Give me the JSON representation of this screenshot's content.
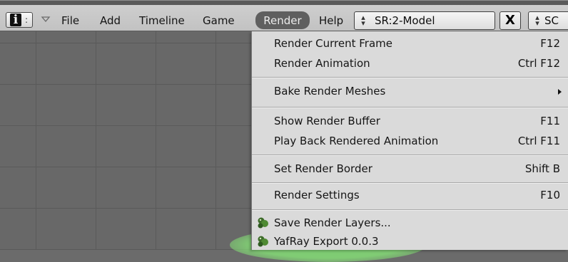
{
  "header": {
    "info_separator": ":",
    "menus": [
      "File",
      "Add",
      "Timeline",
      "Game",
      "Render",
      "Help"
    ],
    "active_menu": "Render",
    "scene_selector": {
      "arrows": "↕",
      "value": "SR:2-Model"
    },
    "close_label": "X",
    "screen_selector": {
      "arrows": "↕",
      "value": "SC"
    }
  },
  "render_menu": {
    "items": [
      {
        "label": "Render Current Frame",
        "shortcut": "F12"
      },
      {
        "label": "Render Animation",
        "shortcut": "Ctrl F12"
      },
      {
        "label": "Bake Render Meshes",
        "submenu": true
      },
      {
        "label": "Show Render Buffer",
        "shortcut": "F11"
      },
      {
        "label": "Play Back Rendered Animation",
        "shortcut": "Ctrl F11"
      },
      {
        "label": "Set Render Border",
        "shortcut": "Shift B"
      },
      {
        "label": "Render Settings",
        "shortcut": "F10"
      },
      {
        "label": "Save Render Layers...",
        "icon": "python-script-icon"
      },
      {
        "label": "YafRay Export 0.0.3",
        "icon": "python-script-icon",
        "highlighted": true
      }
    ]
  },
  "colors": {
    "header_bg": "#c8c8c8",
    "viewport_bg": "#686868",
    "menu_bg": "#dadada",
    "active_menu_bg": "#5f5f5f",
    "highlight_glow": "#7cd670"
  }
}
